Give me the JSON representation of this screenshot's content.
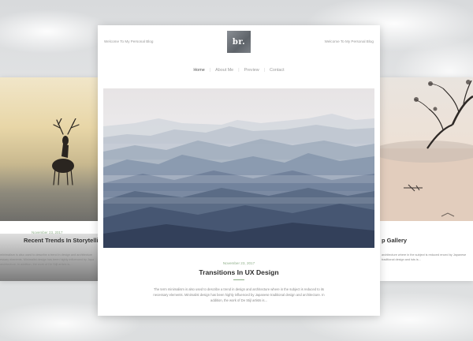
{
  "header": {
    "welcome_left": "Welcome To My Personal Blog",
    "welcome_right": "Welcome To My Personal Blog",
    "logo_text": "br."
  },
  "nav": {
    "items": [
      {
        "label": "Home",
        "active": true
      },
      {
        "label": "About Me",
        "active": false
      },
      {
        "label": "Preview",
        "active": false
      },
      {
        "label": "Contact",
        "active": false
      }
    ]
  },
  "main_post": {
    "date": "November 23, 2017",
    "title": "Transitions In UX Design",
    "excerpt": "The term minimalism is also used to describe a trend in design and architecture where in the subject is reduced to its necessary elements. Minimalist design has been highly influenced by Japanese traditional design and architecture. In addition, the work of De Stijl artists is..."
  },
  "left_post": {
    "date": "November 23, 2017",
    "title": "Recent Trends In Storytelling",
    "excerpt": "minimalism is also used to describe a trend in design and architecture essary elements. Minimalist design has been highly influenced by Japa architecture. In addition, the work of De Stijl artists is..."
  },
  "right_post": {
    "title": "p Gallery",
    "excerpt": "architecture where in the subject is reduced enced by Japanese traditional design and ists is..."
  },
  "colors": {
    "accent_green": "#8fb08a",
    "title_text": "#2d2d2d"
  }
}
